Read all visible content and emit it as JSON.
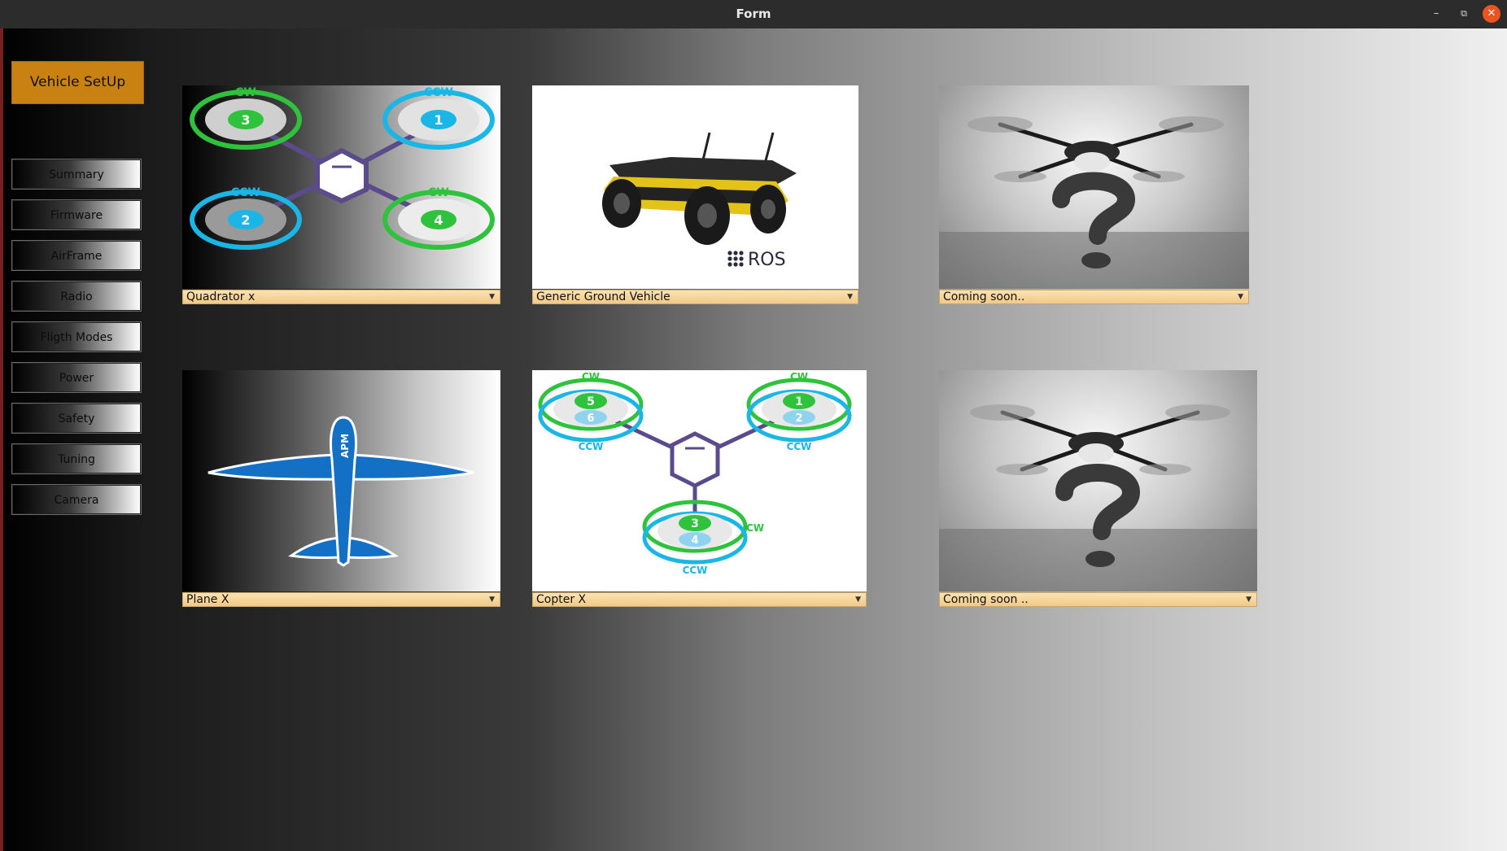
{
  "window": {
    "title": "Form",
    "min_glyph": "–",
    "max_glyph": "⧉",
    "close_glyph": "✕"
  },
  "sidebar": {
    "header": "Vehicle SetUp",
    "items": [
      {
        "label": "Summary"
      },
      {
        "label": "Firmware"
      },
      {
        "label": "AirFrame"
      },
      {
        "label": "Radio"
      },
      {
        "label": "Fligth Modes"
      },
      {
        "label": "Power"
      },
      {
        "label": "Safety"
      },
      {
        "label": "Tuning"
      },
      {
        "label": "Camera"
      }
    ]
  },
  "vehicles": [
    {
      "selected": "Quadrator x",
      "image_icon": "quadcopter-x-diagram",
      "rotors": [
        {
          "num": "3",
          "dir": "CW"
        },
        {
          "num": "1",
          "dir": "CCW"
        },
        {
          "num": "2",
          "dir": "CCW"
        },
        {
          "num": "4",
          "dir": "CW"
        }
      ]
    },
    {
      "selected": "Generic Ground Vehicle",
      "image_icon": "ground-rover-photo",
      "logo_text": "ROS"
    },
    {
      "selected": "Coming soon..",
      "image_icon": "drone-question-photo"
    },
    {
      "selected": "Plane X",
      "image_icon": "plane-diagram",
      "fuselage_text": "APM"
    },
    {
      "selected": "Copter X",
      "image_icon": "hexacopter-y6-diagram",
      "rotors": [
        {
          "num": "5",
          "sub": "6",
          "dir_top": "CW",
          "dir_bot": "CCW"
        },
        {
          "num": "1",
          "sub": "2",
          "dir_top": "CW",
          "dir_bot": "CCW"
        },
        {
          "num": "3",
          "sub": "4",
          "dir_top": "CW",
          "dir_bot": "CCW"
        }
      ]
    },
    {
      "selected": "Coming soon ..",
      "image_icon": "drone-question-photo"
    }
  ],
  "colors": {
    "accent": "#c98212",
    "combo": "#f6d49c",
    "cw_green": "#2fc23c",
    "ccw_blue": "#19b6e6",
    "frame_purple": "#5b4b8a",
    "plane_blue": "#1470c4"
  }
}
